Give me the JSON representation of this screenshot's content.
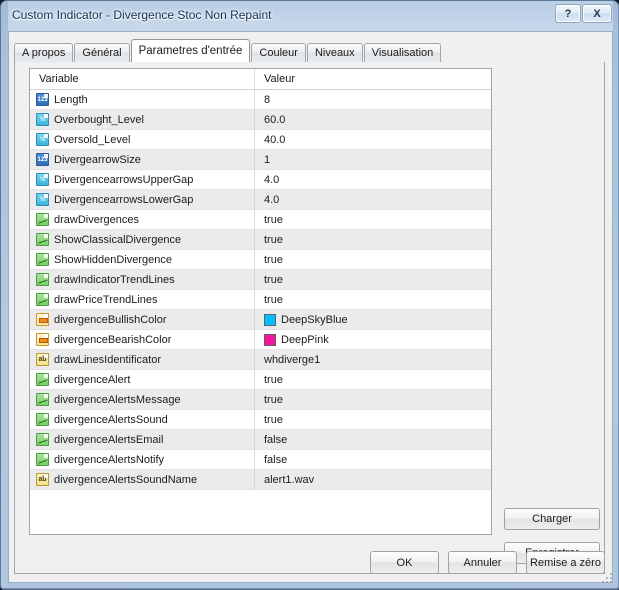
{
  "window": {
    "title": "Custom Indicator - Divergence Stoc Non Repaint",
    "help_button": "?",
    "close_button": "X"
  },
  "tabs": [
    {
      "label": "A propos",
      "active": false
    },
    {
      "label": "Général",
      "active": false
    },
    {
      "label": "Parametres d'entrée",
      "active": true
    },
    {
      "label": "Couleur",
      "active": false
    },
    {
      "label": "Niveaux",
      "active": false
    },
    {
      "label": "Visualisation",
      "active": false
    }
  ],
  "grid": {
    "headers": {
      "variable": "Variable",
      "value": "Valeur"
    },
    "rows": [
      {
        "icon": "int-icon",
        "type": "int",
        "name": "Length",
        "value": "8"
      },
      {
        "icon": "double-icon",
        "type": "double",
        "name": "Overbought_Level",
        "value": "60.0"
      },
      {
        "icon": "double-icon",
        "type": "double",
        "name": "Oversold_Level",
        "value": "40.0"
      },
      {
        "icon": "int-icon",
        "type": "int",
        "name": "DivergearrowSize",
        "value": "1"
      },
      {
        "icon": "double-icon",
        "type": "double",
        "name": "DivergencearrowsUpperGap",
        "value": "4.0"
      },
      {
        "icon": "double-icon",
        "type": "double",
        "name": "DivergencearrowsLowerGap",
        "value": "4.0"
      },
      {
        "icon": "bool-icon",
        "type": "bool",
        "name": "drawDivergences",
        "value": "true"
      },
      {
        "icon": "bool-icon",
        "type": "bool",
        "name": "ShowClassicalDivergence",
        "value": "true"
      },
      {
        "icon": "bool-icon",
        "type": "bool",
        "name": "ShowHiddenDivergence",
        "value": "true"
      },
      {
        "icon": "bool-icon",
        "type": "bool",
        "name": "drawIndicatorTrendLines",
        "value": "true"
      },
      {
        "icon": "bool-icon",
        "type": "bool",
        "name": "drawPriceTrendLines",
        "value": "true"
      },
      {
        "icon": "color-icon",
        "type": "color",
        "name": "divergenceBullishColor",
        "value": "DeepSkyBlue",
        "swatch": "#00BFFF"
      },
      {
        "icon": "color-icon",
        "type": "color",
        "name": "divergenceBearishColor",
        "value": "DeepPink",
        "swatch": "#F4169C"
      },
      {
        "icon": "string-icon",
        "type": "string",
        "name": "drawLinesIdentificator",
        "value": "whdiverge1",
        "icon_text": "ab"
      },
      {
        "icon": "bool-icon",
        "type": "bool",
        "name": "divergenceAlert",
        "value": "true"
      },
      {
        "icon": "bool-icon",
        "type": "bool",
        "name": "divergenceAlertsMessage",
        "value": "true"
      },
      {
        "icon": "bool-icon",
        "type": "bool",
        "name": "divergenceAlertsSound",
        "value": "true"
      },
      {
        "icon": "bool-icon",
        "type": "bool",
        "name": "divergenceAlertsEmail",
        "value": "false"
      },
      {
        "icon": "bool-icon",
        "type": "bool",
        "name": "divergenceAlertsNotify",
        "value": "false"
      },
      {
        "icon": "string-icon",
        "type": "string",
        "name": "divergenceAlertsSoundName",
        "value": "alert1.wav",
        "icon_text": "ab"
      }
    ]
  },
  "side_buttons": {
    "load": "Charger",
    "save": "Enregistrer"
  },
  "footer_buttons": {
    "ok": "OK",
    "cancel": "Annuler",
    "reset": "Remise a zéro"
  },
  "colors": {
    "accent_blue": "#00BFFF",
    "accent_pink": "#F4169C",
    "window_bg": "#f0f0f0",
    "row_alt": "#ebebeb"
  }
}
